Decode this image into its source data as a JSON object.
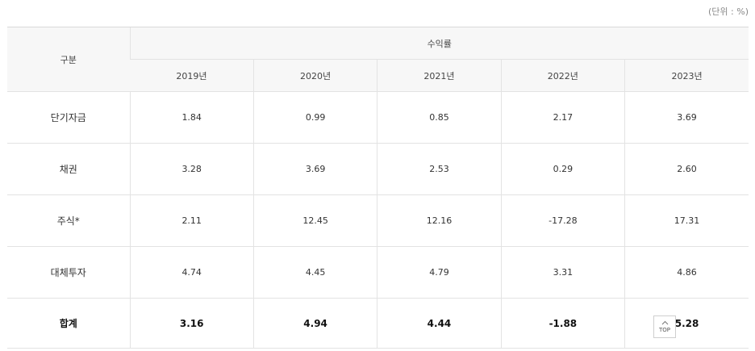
{
  "unit_note": "(단위 : %)",
  "table": {
    "header_category": "구분",
    "header_group": "수익률",
    "years": [
      "2019년",
      "2020년",
      "2021년",
      "2022년",
      "2023년"
    ],
    "rows": [
      {
        "label": "단기자금",
        "values": [
          "1.84",
          "0.99",
          "0.85",
          "2.17",
          "3.69"
        ]
      },
      {
        "label": "채권",
        "values": [
          "3.28",
          "3.69",
          "2.53",
          "0.29",
          "2.60"
        ]
      },
      {
        "label": "주식*",
        "values": [
          "2.11",
          "12.45",
          "12.16",
          "-17.28",
          "17.31"
        ]
      },
      {
        "label": "대체투자",
        "values": [
          "4.74",
          "4.45",
          "4.79",
          "3.31",
          "4.86"
        ]
      },
      {
        "label": "합계",
        "values": [
          "3.16",
          "4.94",
          "4.44",
          "-1.88",
          "5.28"
        ]
      }
    ]
  },
  "top_button": {
    "label": "TOP",
    "icon": "chevron-up-icon"
  }
}
